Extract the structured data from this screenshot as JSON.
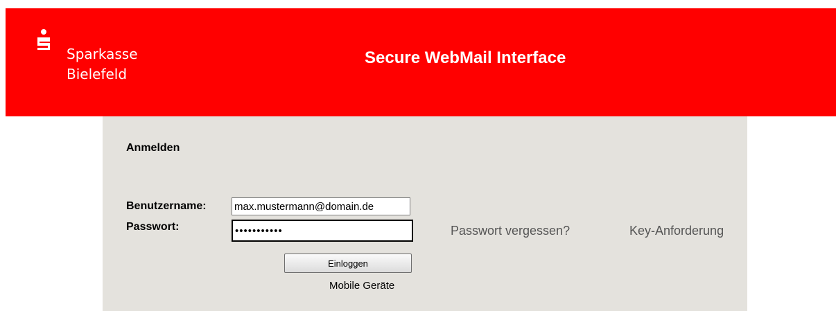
{
  "header": {
    "bank_line1": "Sparkasse",
    "bank_line2": "Bielefeld",
    "title": "Secure WebMail Interface",
    "logo_icon": "sparkasse-s-logo",
    "background_color": "#ff0000"
  },
  "login": {
    "heading": "Anmelden",
    "username_label": "Benutzername:",
    "username_value": "max.mustermann@domain.de",
    "password_label": "Passwort:",
    "password_value": "•••••••••••",
    "forgot_password": "Passwort vergessen?",
    "key_request": "Key-Anforderung",
    "login_button": "Einloggen",
    "mobile_link": "Mobile Geräte",
    "panel_color": "#e4e2dd"
  }
}
